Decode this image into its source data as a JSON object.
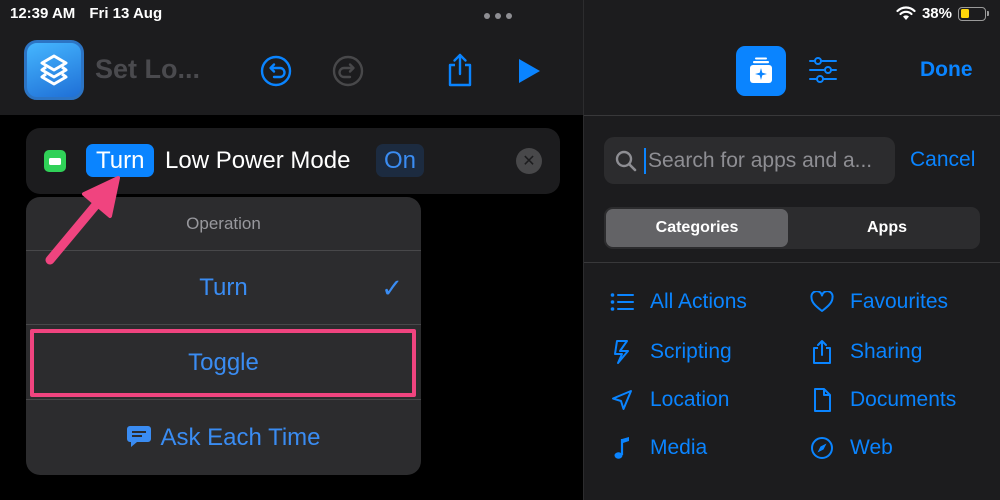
{
  "status_bar": {
    "time": "12:39 AM",
    "date": "Fri 13 Aug",
    "battery_percent": "38%",
    "battery_level": 0.38,
    "wifi_icon": "wifi-icon"
  },
  "editor": {
    "shortcut_title": "Set Lo...",
    "toolbar_icons": [
      "undo-icon",
      "redo-icon",
      "share-icon",
      "play-icon"
    ],
    "action": {
      "verb_token": "Turn",
      "text": "Low Power Mode",
      "value_token": "On",
      "icon": "battery-icon",
      "accent": "#30d158"
    },
    "dropdown": {
      "header": "Operation",
      "items": [
        {
          "label": "Turn",
          "selected": true
        },
        {
          "label": "Toggle",
          "selected": false,
          "highlighted": true
        },
        {
          "label": "Ask Each Time",
          "selected": false,
          "icon": "chat-bubble-icon"
        }
      ]
    }
  },
  "sidebar": {
    "done_label": "Done",
    "search": {
      "placeholder": "Search for apps and a...",
      "cancel_label": "Cancel"
    },
    "segments": [
      {
        "label": "Categories",
        "active": true
      },
      {
        "label": "Apps",
        "active": false
      }
    ],
    "categories": [
      {
        "label": "All Actions",
        "icon": "list-icon"
      },
      {
        "label": "Favourites",
        "icon": "heart-icon"
      },
      {
        "label": "Scripting",
        "icon": "scripting-icon"
      },
      {
        "label": "Sharing",
        "icon": "share-icon"
      },
      {
        "label": "Location",
        "icon": "location-arrow-icon"
      },
      {
        "label": "Documents",
        "icon": "document-icon"
      },
      {
        "label": "Media",
        "icon": "music-note-icon"
      },
      {
        "label": "Web",
        "icon": "compass-icon"
      }
    ]
  },
  "colors": {
    "accent": "#0a84ff",
    "highlight": "#f0447f",
    "panel": "#1c1c1e"
  }
}
